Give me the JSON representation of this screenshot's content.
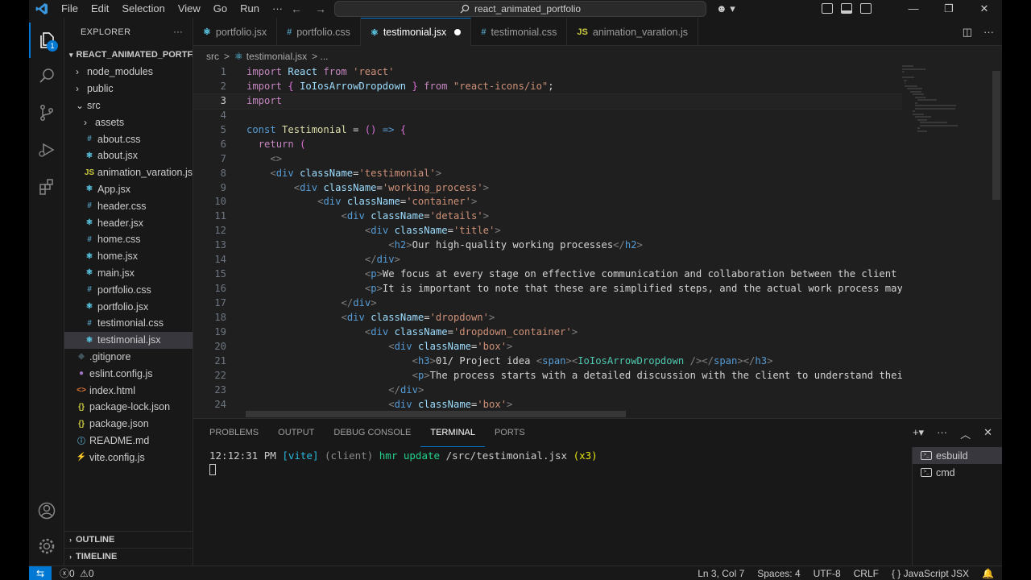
{
  "titlebar": {
    "menu": [
      "File",
      "Edit",
      "Selection",
      "View",
      "Go",
      "Run",
      "···"
    ],
    "search_text": "react_animated_portfolio"
  },
  "sidebar": {
    "title": "EXPLORER",
    "project": "REACT_ANIMATED_PORTF...",
    "files": [
      {
        "name": "node_modules",
        "type": "folder",
        "icon": "chevron-right-icon"
      },
      {
        "name": "public",
        "type": "folder",
        "icon": "chevron-right-icon"
      },
      {
        "name": "src",
        "type": "folder-open",
        "icon": "chevron-down-icon"
      },
      {
        "name": "assets",
        "type": "folder",
        "icon": "chevron-right-icon"
      },
      {
        "name": "about.css",
        "type": "css",
        "icon": "#"
      },
      {
        "name": "about.jsx",
        "type": "jsx",
        "icon": "⚛"
      },
      {
        "name": "animation_varation.js",
        "type": "js",
        "icon": "JS"
      },
      {
        "name": "App.jsx",
        "type": "jsx",
        "icon": "⚛"
      },
      {
        "name": "header.css",
        "type": "css",
        "icon": "#"
      },
      {
        "name": "header.jsx",
        "type": "jsx",
        "icon": "⚛"
      },
      {
        "name": "home.css",
        "type": "css",
        "icon": "#"
      },
      {
        "name": "home.jsx",
        "type": "jsx",
        "icon": "⚛"
      },
      {
        "name": "main.jsx",
        "type": "jsx",
        "icon": "⚛"
      },
      {
        "name": "portfolio.css",
        "type": "css",
        "icon": "#"
      },
      {
        "name": "portfolio.jsx",
        "type": "jsx",
        "icon": "⚛"
      },
      {
        "name": "testimonial.css",
        "type": "css",
        "icon": "#"
      },
      {
        "name": "testimonial.jsx",
        "type": "jsx",
        "icon": "⚛",
        "selected": true
      },
      {
        "name": ".gitignore",
        "type": "git",
        "icon": "◆"
      },
      {
        "name": "eslint.config.js",
        "type": "eslint",
        "icon": "●"
      },
      {
        "name": "index.html",
        "type": "html",
        "icon": "<>"
      },
      {
        "name": "package-lock.json",
        "type": "json",
        "icon": "{}"
      },
      {
        "name": "package.json",
        "type": "json",
        "icon": "{}"
      },
      {
        "name": "README.md",
        "type": "md",
        "icon": "ⓘ"
      },
      {
        "name": "vite.config.js",
        "type": "vite",
        "icon": "⚡"
      }
    ],
    "outline": "OUTLINE",
    "timeline": "TIMELINE"
  },
  "tabs": [
    {
      "label": "portfolio.jsx",
      "icon": "⚛",
      "active": false
    },
    {
      "label": "portfolio.css",
      "icon": "#",
      "active": false
    },
    {
      "label": "testimonial.jsx",
      "icon": "⚛",
      "active": true,
      "dirty": true
    },
    {
      "label": "testimonial.css",
      "icon": "#",
      "active": false
    },
    {
      "label": "animation_varation.js",
      "icon": "JS",
      "active": false
    }
  ],
  "breadcrumb": {
    "folder": "src",
    "sep": ">",
    "file": "testimonial.jsx",
    "more": "> ..."
  },
  "code_lines": [
    "import React from 'react'",
    "import { IoIosArrowDropdown } from \"react-icons/io\";",
    "import ",
    "",
    "const Testimonial = () => {",
    "  return (",
    "    <>",
    "    <div className='testimonial'>",
    "        <div className='working_process'>",
    "            <div className='container'>",
    "                <div className='details'>",
    "                    <div className='title'>",
    "                        <h2>Our high-quality working processes</h2>",
    "                    </div>",
    "                    <p>We focus at every stage on effective communication and collaboration between the client a",
    "                    <p>It is important to note that these are simplified steps, and the actual work process may ",
    "                </div>",
    "                <div className='dropdown'>",
    "                    <div className='dropdown_container'>",
    "                        <div className='box'>",
    "                            <h3>01/ Project idea <span><IoIosArrowDropdown /></span></h3>",
    "                            <p>The process starts with a detailed discussion with the client to understand their",
    "                        </div>",
    "                        <div className='box'>"
  ],
  "cursor_line": 3,
  "panel": {
    "tabs": [
      "PROBLEMS",
      "OUTPUT",
      "DEBUG CONSOLE",
      "TERMINAL",
      "PORTS"
    ],
    "active_tab": "TERMINAL",
    "terminal_line": {
      "time": "12:12:31 PM",
      "tag": "[vite]",
      "client": "(client)",
      "action": "hmr update",
      "path": "/src/testimonial.jsx",
      "count": "(x3)"
    },
    "terminals": [
      "esbuild",
      "cmd"
    ]
  },
  "status": {
    "errors": "0",
    "warnings": "0",
    "position": "Ln 3, Col 7",
    "spaces": "Spaces: 4",
    "encoding": "UTF-8",
    "eol": "CRLF",
    "language": "JavaScript JSX",
    "language_icon": "{ }"
  },
  "colors": {
    "accent": "#0078d4",
    "keyword": "#c586c0",
    "string": "#ce9178",
    "variable": "#9cdcfe",
    "tag": "#569cd6"
  }
}
